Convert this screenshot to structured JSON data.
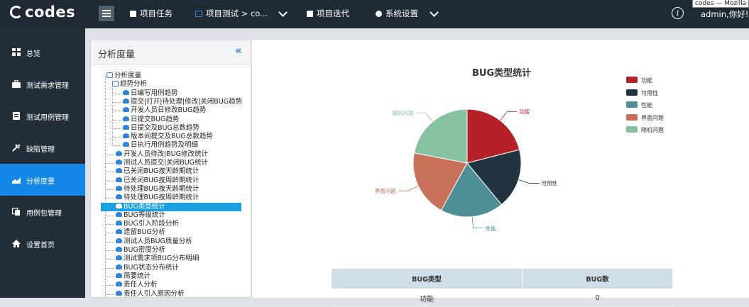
{
  "window_tooltip": "codes — Mozilla",
  "app": {
    "logo": "codes"
  },
  "topnav": [
    {
      "label": "项目任务",
      "icon": "briefcase-icon"
    },
    {
      "label": "项目测试 > co...",
      "icon": "monitor-icon"
    },
    {
      "label": "项目迭代",
      "icon": "document-icon"
    },
    {
      "label": "系统设置",
      "icon": "gear-icon"
    }
  ],
  "user": {
    "greeting": "admin,你好!"
  },
  "sidebar": {
    "items": [
      {
        "label": "总览",
        "icon": "grid-icon"
      },
      {
        "label": "测试需求管理",
        "icon": "briefcase-icon"
      },
      {
        "label": "测试用例管理",
        "icon": "clipboard-icon"
      },
      {
        "label": "缺陷管理",
        "icon": "wrench-icon"
      },
      {
        "label": "分析度量",
        "icon": "area-chart-icon",
        "active": true
      },
      {
        "label": "用例包管理",
        "icon": "copy-icon"
      },
      {
        "label": "设置首页",
        "icon": "home-icon"
      }
    ]
  },
  "tree": {
    "title": "分析度量",
    "root": "分析度量",
    "folder": "趋势分析",
    "trend_children": [
      "日编写用例趋势",
      "提交|打开|待处理|修改|关闭BUG趋势",
      "开发人员日修改BUG趋势",
      "日提交BUG趋势",
      "日提交及BUG总数趋势",
      "版本间提交及BUG总数趋势",
      "日执行用例趋势及明细"
    ],
    "items": [
      "开发人员待改|BUG修改统计",
      "测试人员提交|关闭BUG统计",
      "已关闭BUG按天龄期统计",
      "已关闭BUG按周龄期统计",
      "待处理BUG按天龄期统计",
      "待处理BUG按周龄期统计",
      "BUG类型统计",
      "BUG等级统计",
      "BUG引入阶段分析",
      "遗留BUG分析",
      "测试人员BUG质量分析",
      "BUG密度分析",
      "测试需求项BUG分布明细",
      "BUG状态分布统计",
      "简要统计",
      "责任人分析",
      "责任人引入原因分析"
    ],
    "selected": "BUG类型统计"
  },
  "chart_data": {
    "type": "pie",
    "title": "BUG类型统计",
    "categories": [
      "功能",
      "可用性",
      "性能",
      "界面问题",
      "随机问题"
    ],
    "values": [
      21,
      18,
      19,
      20,
      22
    ],
    "colors": [
      "#b52127",
      "#223340",
      "#4d8f95",
      "#c8705a",
      "#88c1a2"
    ],
    "legend": "top-right"
  },
  "table": {
    "headers": [
      "BUG类型",
      "BUG数"
    ],
    "rows": [
      [
        "功能",
        "0"
      ]
    ]
  }
}
